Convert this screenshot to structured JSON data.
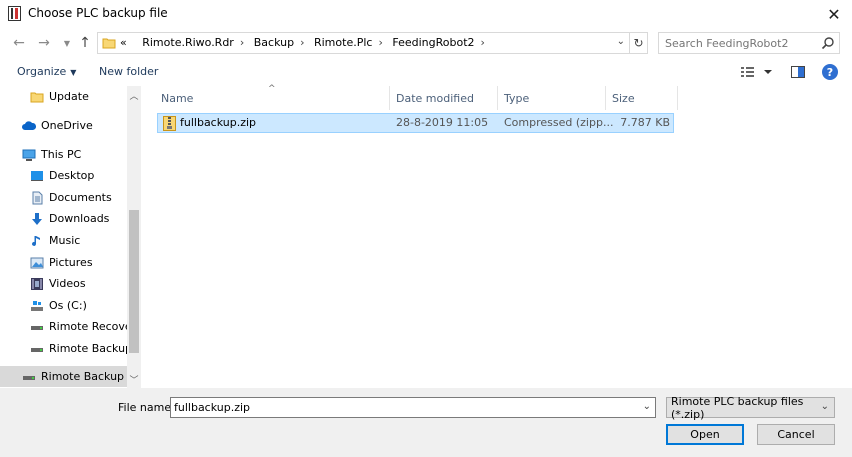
{
  "window": {
    "title": "Choose PLC backup file"
  },
  "address": {
    "overflow": "«",
    "crumbs": [
      "Rimote.Riwo.Rdr",
      "Backup",
      "Rimote.Plc",
      "FeedingRobot2"
    ]
  },
  "search": {
    "placeholder": "Search FeedingRobot2"
  },
  "toolbar": {
    "organize": "Organize",
    "new_folder": "New folder",
    "help": "?"
  },
  "sidebar": {
    "items": [
      {
        "label": "Update",
        "icon": "folder-icon"
      },
      {
        "label": "OneDrive",
        "icon": "cloud-icon"
      },
      {
        "label": "This PC",
        "icon": "computer-icon"
      },
      {
        "label": "Desktop",
        "icon": "desktop-icon"
      },
      {
        "label": "Documents",
        "icon": "documents-icon"
      },
      {
        "label": "Downloads",
        "icon": "downloads-icon"
      },
      {
        "label": "Music",
        "icon": "music-icon"
      },
      {
        "label": "Pictures",
        "icon": "pictures-icon"
      },
      {
        "label": "Videos",
        "icon": "videos-icon"
      },
      {
        "label": "Os (C:)",
        "icon": "drive-icon"
      },
      {
        "label": "Rimote Recovery",
        "icon": "drive-icon"
      },
      {
        "label": "Rimote Backup &",
        "icon": "drive-icon"
      },
      {
        "label": "Rimote Backup &",
        "icon": "drive-icon"
      }
    ]
  },
  "columns": {
    "name": "Name",
    "date": "Date modified",
    "type": "Type",
    "size": "Size"
  },
  "files": [
    {
      "name": "fullbackup.zip",
      "date": "28-8-2019 11:05",
      "type": "Compressed (zipp...",
      "size": "7.787 KB"
    }
  ],
  "bottom": {
    "filename_label": "File name:",
    "filename_value": "fullbackup.zip",
    "filter": "Rimote PLC backup files (*.zip)",
    "open": "Open",
    "cancel": "Cancel"
  }
}
